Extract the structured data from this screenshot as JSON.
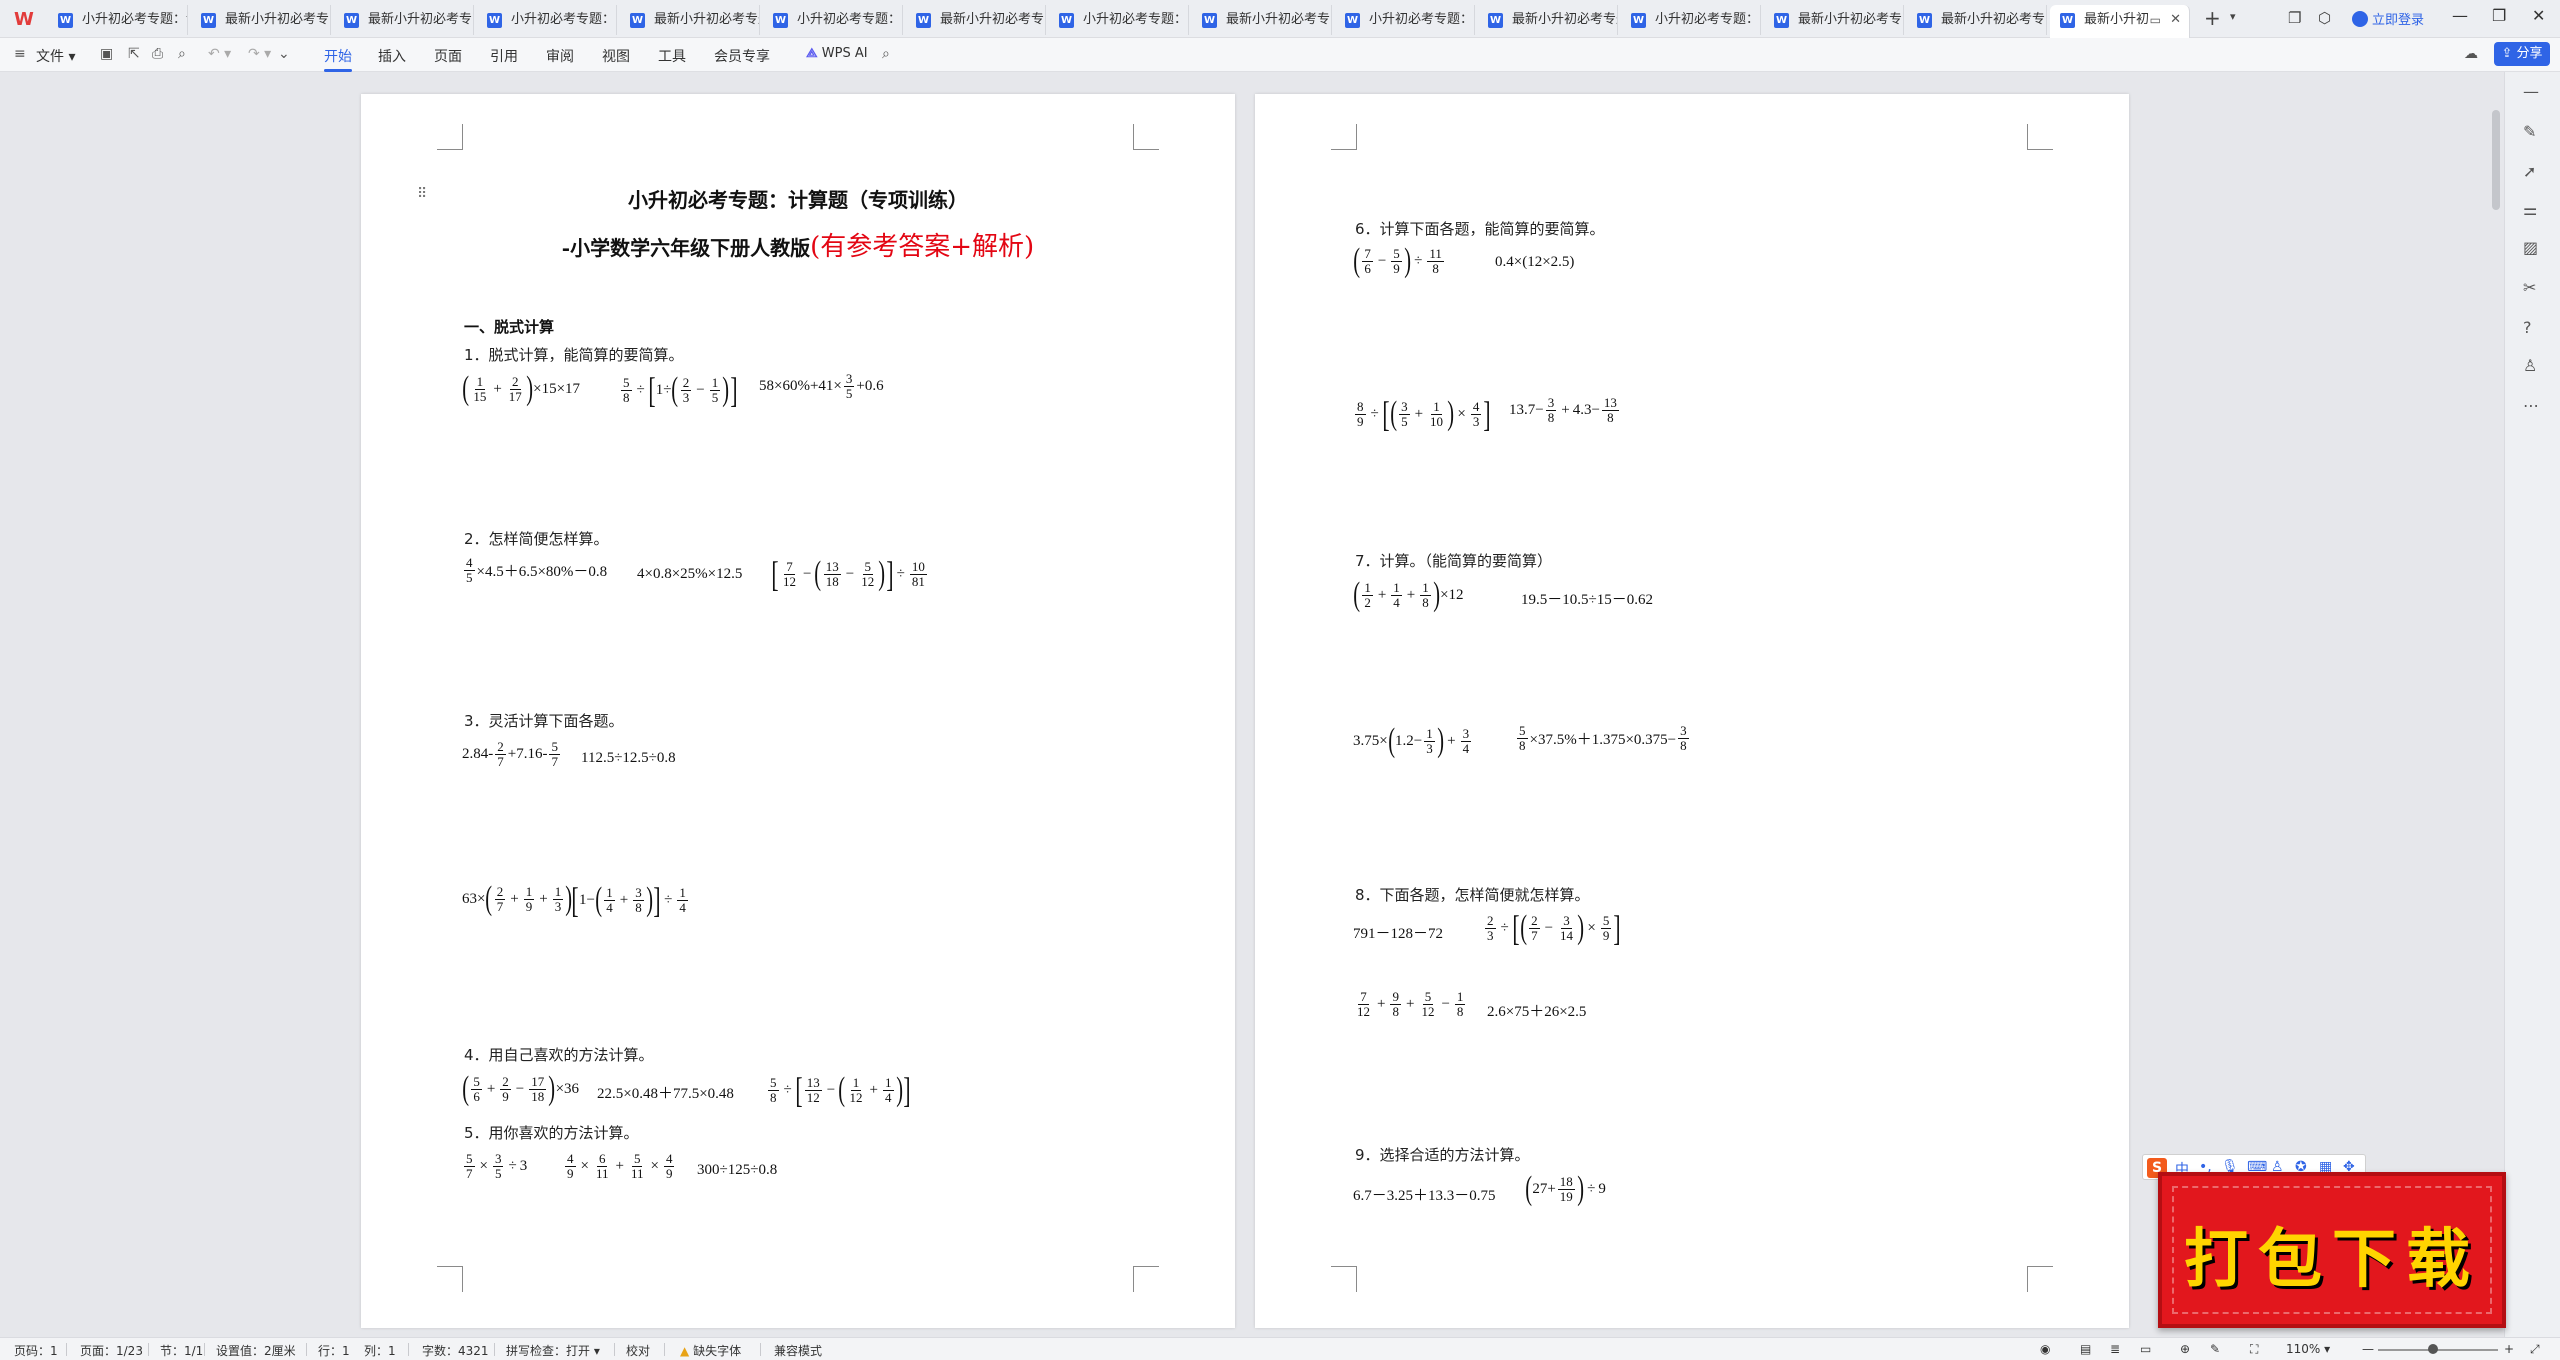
{
  "tabs": [
    {
      "label": "小升初必考专题：计"
    },
    {
      "label": "最新小升初必考专"
    },
    {
      "label": "最新小升初必考专"
    },
    {
      "label": "小升初必考专题："
    },
    {
      "label": "最新小升初必考专题"
    },
    {
      "label": "小升初必考专题："
    },
    {
      "label": "最新小升初必考专"
    },
    {
      "label": "小升初必考专题："
    },
    {
      "label": "最新小升初必考专"
    },
    {
      "label": "小升初必考专题："
    },
    {
      "label": "最新小升初必考专题"
    },
    {
      "label": "小升初必考专题："
    },
    {
      "label": "最新小升初必考专"
    },
    {
      "label": "最新小升初必考专"
    },
    {
      "label": "最新小升初"
    }
  ],
  "login_label": "立即登录",
  "menu": {
    "file": "文件",
    "items": [
      "开始",
      "插入",
      "页面",
      "引用",
      "审阅",
      "视图",
      "工具",
      "会员专享"
    ],
    "active": "开始",
    "wps_ai": "WPS AI",
    "share": "分享"
  },
  "page1": {
    "title_line1": "小升初必考专题：计算题（专项训练）",
    "title_line2_prefix": "-小学数学六年级下册人教版",
    "title_line2_red": "(有参考答案+解析)",
    "section1": "一、脱式计算",
    "q1": "1．脱式计算，能简算的要简算。",
    "q2": "2．怎样简便怎样算。",
    "q3": "3．灵活计算下面各题。",
    "q4": "4．用自己喜欢的方法计算。",
    "q5": "5．用你喜欢的方法计算。",
    "e_q2_b": "4×0.8×25%×12.5",
    "e_q3_b": "112.5÷12.5÷0.8",
    "e_q4_b": "22.5×0.48＋77.5×0.48",
    "e_q5_c": "300÷125÷0.8"
  },
  "page2": {
    "q6": "6．计算下面各题，能简算的要简算。",
    "q7": "7．计算。（能简算的要简算）",
    "q8": "8．下面各题，怎样简便就怎样算。",
    "q9": "9．选择合适的方法计算。",
    "e_q6_b": "0.4×(12×2.5)",
    "e_q7_b": "19.5－10.5÷15－0.62",
    "e_q8_a": "791－128－72",
    "e_q8_d": "2.6×75＋26×2.5",
    "e_q9_a": "6.7－3.25＋13.3－0.75"
  },
  "status": {
    "page_num": "页码：1",
    "pages": "页面：1/23",
    "section": "节：1/1",
    "setting": "设置值：2厘米",
    "row": "行：1",
    "col": "列：1",
    "words": "字数：4321",
    "spell": "拼写检查：打开",
    "proof": "校对",
    "missing_font": "缺失字体",
    "compat": "兼容模式",
    "zoom": "110%"
  },
  "banner": {
    "text": "打包下载"
  },
  "ime": {
    "mode": "中"
  }
}
